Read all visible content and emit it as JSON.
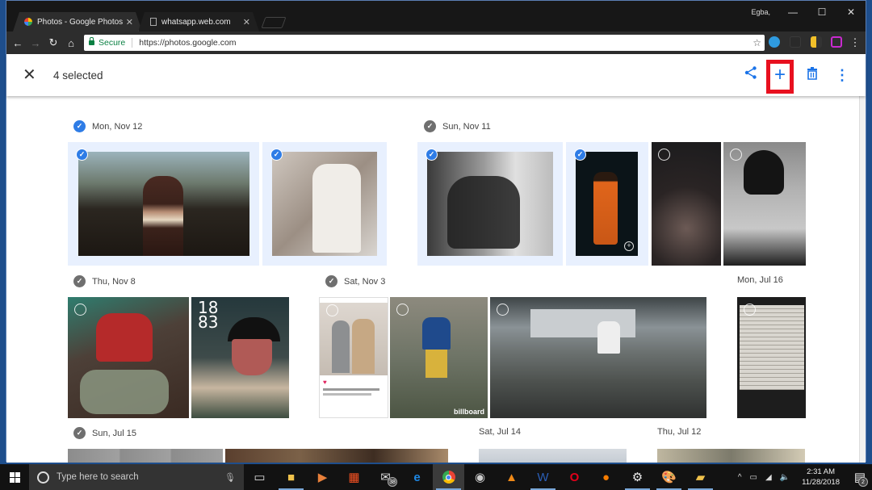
{
  "browser": {
    "tabs": [
      {
        "title": "Photos - Google Photos",
        "active": true,
        "icon": "google-photos-icon"
      },
      {
        "title": "whatsapp.web.com",
        "active": false,
        "icon": "document-icon"
      }
    ],
    "profile_name": "Egba,",
    "window_controls": {
      "minimize": "—",
      "maximize": "☐",
      "close": "✕"
    },
    "nav": {
      "back": "←",
      "forward": "→",
      "reload": "↻",
      "home": "⌂"
    },
    "address": {
      "secure_label": "Secure",
      "url": "https://photos.google.com"
    },
    "bookmark_star": "☆",
    "menu": "⋮"
  },
  "photos": {
    "selection": {
      "close_icon": "✕",
      "count_label": "4 selected"
    },
    "actions": {
      "share": "share-icon",
      "add": "+",
      "delete": "trash-icon",
      "more": "⋮"
    },
    "groups": [
      {
        "date": "Mon, Nov 12",
        "check_state": "selected"
      },
      {
        "date": "Sun, Nov 11",
        "check_state": "partial"
      },
      {
        "date": "Thu, Nov 8",
        "check_state": "unselected"
      },
      {
        "date": "Sat, Nov 3",
        "check_state": "unselected"
      },
      {
        "date": "Mon, Jul 16",
        "check_state": "none"
      },
      {
        "date": "Sun, Jul 15",
        "check_state": "unselected"
      },
      {
        "date": "Sat, Jul 14",
        "check_state": "none"
      },
      {
        "date": "Thu, Jul 12",
        "check_state": "none"
      }
    ],
    "photos": [
      {
        "group": "Mon, Nov 12",
        "desc": "man in striped sweater against hills",
        "selected": true
      },
      {
        "group": "Mon, Nov 12",
        "desc": "man in white outfit seated",
        "selected": true
      },
      {
        "group": "Sun, Nov 11",
        "desc": "black and white man seated on floor",
        "selected": true
      },
      {
        "group": "Sun, Nov 11",
        "desc": "performer in orange jumpsuit on stage",
        "selected": true
      },
      {
        "group": "Sun, Nov 11",
        "desc": "performer in smoke on dark stage",
        "selected": false
      },
      {
        "group": "Sun, Nov 11",
        "desc": "black and white portrait with dreadlocks",
        "selected": false
      },
      {
        "group": "Thu, Nov 8",
        "desc": "man crouching with bags",
        "selected": false
      },
      {
        "group": "Thu, Nov 8",
        "desc": "magazine cover 1883 BLACK",
        "selected": false
      },
      {
        "group": "Sat, Nov 3",
        "desc": "instagram screenshot two men",
        "selected": false
      },
      {
        "group": "Sat, Nov 3",
        "desc": "man in blue jersey billboard",
        "selected": false
      },
      {
        "group": "Sat, Nov 3",
        "desc": "man sitting on brick wall",
        "selected": false
      },
      {
        "group": "Mon, Jul 16",
        "desc": "handwritten letter",
        "selected": false
      }
    ]
  },
  "taskbar": {
    "search_placeholder": "Type here to search",
    "mail_badge": "38",
    "time": "2:31 AM",
    "date": "11/28/2018",
    "notifications_badge": "2"
  },
  "colors": {
    "accent": "#1a73e8",
    "selected_bg": "#e8f0fe",
    "highlight_box": "#e8101f",
    "secure_green": "#0b8043"
  }
}
